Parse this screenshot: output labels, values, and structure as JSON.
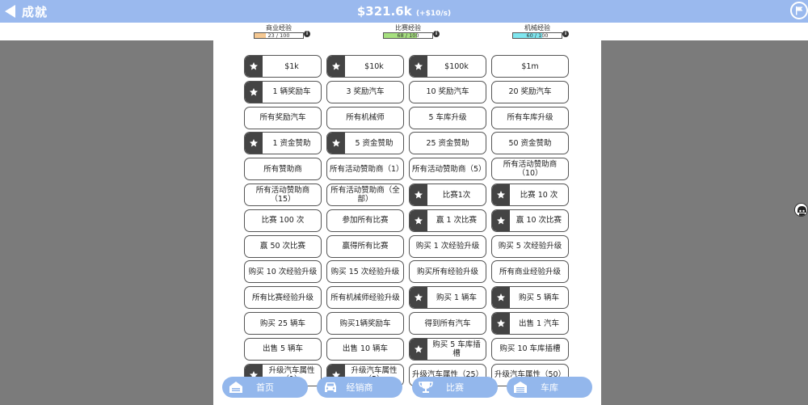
{
  "header": {
    "back_label": "成就",
    "money": "$321.6k",
    "rate": "(+$10/s)"
  },
  "xp_bars": [
    {
      "label": "商业经验",
      "value": "23 / 100",
      "progress": 0.23,
      "color": "#f5c892"
    },
    {
      "label": "比赛经验",
      "value": "68 / 100",
      "progress": 0.68,
      "color": "#a6e07f"
    },
    {
      "label": "机械经验",
      "value": "60 / 100",
      "progress": 0.6,
      "color": "#7fe6ef"
    }
  ],
  "achievements": [
    {
      "label": "$1k",
      "done": true
    },
    {
      "label": "$10k",
      "done": true
    },
    {
      "label": "$100k",
      "done": true
    },
    {
      "label": "$1m",
      "done": false
    },
    {
      "label": "1 辆奖励车",
      "done": true
    },
    {
      "label": "3 奖励汽车",
      "done": false
    },
    {
      "label": "10 奖励汽车",
      "done": false
    },
    {
      "label": "20 奖励汽车",
      "done": false
    },
    {
      "label": "所有奖励汽车",
      "done": false
    },
    {
      "label": "所有机械师",
      "done": false
    },
    {
      "label": "5 车库升级",
      "done": false
    },
    {
      "label": "所有车库升级",
      "done": false
    },
    {
      "label": "1 资金赞助",
      "done": true
    },
    {
      "label": "5 资金赞助",
      "done": true
    },
    {
      "label": "25 资金赞助",
      "done": false
    },
    {
      "label": "50 资金赞助",
      "done": false
    },
    {
      "label": "所有赞助商",
      "done": false
    },
    {
      "label": "所有活动赞助商（1）",
      "done": false
    },
    {
      "label": "所有活动赞助商（5）",
      "done": false
    },
    {
      "label": "所有活动赞助商（10）",
      "done": false
    },
    {
      "label": "所有活动赞助商（15）",
      "done": false
    },
    {
      "label": "所有活动赞助商（全部）",
      "done": false
    },
    {
      "label": "比赛1次",
      "done": true
    },
    {
      "label": "比赛 10 次",
      "done": true
    },
    {
      "label": "比赛 100 次",
      "done": false
    },
    {
      "label": "参加所有比赛",
      "done": false
    },
    {
      "label": "赢 1 次比赛",
      "done": true
    },
    {
      "label": "赢 10 次比赛",
      "done": true
    },
    {
      "label": "赢 50 次比赛",
      "done": false
    },
    {
      "label": "赢得所有比赛",
      "done": false
    },
    {
      "label": "购买 1 次经验升级",
      "done": false
    },
    {
      "label": "购买 5 次经验升级",
      "done": false
    },
    {
      "label": "购买 10 次经验升级",
      "done": false
    },
    {
      "label": "购买 15 次经验升级",
      "done": false
    },
    {
      "label": "购买所有经验升级",
      "done": false
    },
    {
      "label": "所有商业经验升级",
      "done": false
    },
    {
      "label": "所有比赛经验升级",
      "done": false
    },
    {
      "label": "所有机械师经验升级",
      "done": false
    },
    {
      "label": "购买 1 辆车",
      "done": true
    },
    {
      "label": "购买 5 辆车",
      "done": true
    },
    {
      "label": "购买 25 辆车",
      "done": false
    },
    {
      "label": "购买1辆奖励车",
      "done": false
    },
    {
      "label": "得到所有汽车",
      "done": false
    },
    {
      "label": "出售 1 汽车",
      "done": true
    },
    {
      "label": "出售 5 辆车",
      "done": false
    },
    {
      "label": "出售 10 辆车",
      "done": false
    },
    {
      "label": "购买 5 车库插槽",
      "done": true
    },
    {
      "label": "购买 10 车库插槽",
      "done": false
    },
    {
      "label": "升级汽车属性（1）",
      "done": true
    },
    {
      "label": "升级汽车属性（5）",
      "done": true
    },
    {
      "label": "升级汽车属性（25）",
      "done": false
    },
    {
      "label": "升级汽车属性（50）",
      "done": false
    }
  ],
  "nav": [
    {
      "label": "首页",
      "icon": "garage-home-icon"
    },
    {
      "label": "经销商",
      "icon": "car-icon"
    },
    {
      "label": "比赛",
      "icon": "trophy-icon"
    },
    {
      "label": "车库",
      "icon": "warehouse-icon"
    }
  ]
}
